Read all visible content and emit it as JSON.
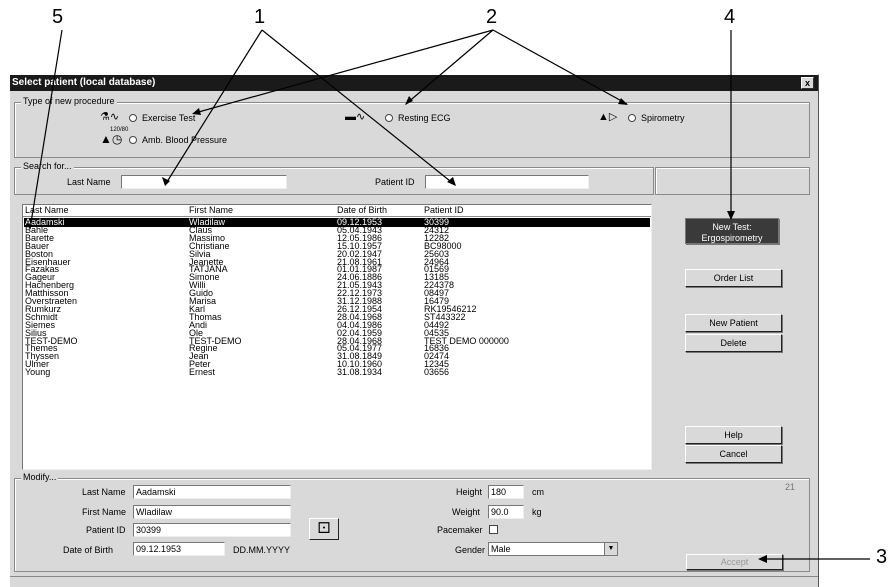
{
  "callouts": [
    "5",
    "1",
    "2",
    "4",
    "3"
  ],
  "window": {
    "title": "Select patient (local database)",
    "close": "x"
  },
  "procedure": {
    "label": "Type of new procedure",
    "exercise": "Exercise Test",
    "resting": "Resting ECG",
    "spiro": "Spirometry",
    "abp": "Amb. Blood Pressure",
    "abp_icon_text": "120/80",
    "icons": [
      "exercise-ecg-icon",
      "resting-ecg-icon",
      "spirometry-icon",
      "blood-pressure-icon"
    ]
  },
  "search": {
    "label": "Search for...",
    "last_name": "Last Name",
    "patient_id": "Patient ID"
  },
  "list": {
    "headers": [
      "Last Name",
      "First Name",
      "Date of Birth",
      "Patient ID"
    ],
    "selected_index": 0,
    "rows": [
      [
        "Aadamski",
        "Wladilaw",
        "09.12.1953",
        "30399"
      ],
      [
        "Bahle",
        "Claus",
        "05.04.1943",
        "24312"
      ],
      [
        "Barette",
        "Massimo",
        "12.05.1986",
        "12282"
      ],
      [
        "Bauer",
        "Christiane",
        "15.10.1957",
        "BC98000"
      ],
      [
        "Boston",
        "Silvia",
        "20.02.1947",
        "25603"
      ],
      [
        "Eisenhauer",
        "Jeanette",
        "21.08.1961",
        "24964"
      ],
      [
        "Fazakas",
        "TATJANA",
        "01.01.1987",
        "01569"
      ],
      [
        "Gageur",
        "Simone",
        "24.06.1886",
        "13185"
      ],
      [
        "Hachenberg",
        "Willi",
        "21.05.1943",
        "224378"
      ],
      [
        "Matthisson",
        "Guido",
        "22.12.1973",
        "08497"
      ],
      [
        "Overstraeten",
        "Marisa",
        "31.12.1988",
        "16479"
      ],
      [
        "Rumkurz",
        "Karl",
        "26.12.1954",
        "RK19546212"
      ],
      [
        "Schmidt",
        "Thomas",
        "28.04.1968",
        "ST443322"
      ],
      [
        "Siemes",
        "Andi",
        "04.04.1986",
        "04492"
      ],
      [
        "Silius",
        "Ole",
        "02.04.1959",
        "04535"
      ],
      [
        "TEST-DEMO",
        "TEST-DEMO",
        "28.04.1968",
        "TEST DEMO 000000"
      ],
      [
        "Themes",
        "Regine",
        "05.04.1977",
        "16836"
      ],
      [
        "Thyssen",
        "Jean",
        "31.08.1849",
        "02474"
      ],
      [
        "Ulmer",
        "Peter",
        "10.10.1960",
        "12345"
      ],
      [
        "Young",
        "Ernest",
        "31.08.1934",
        "03656"
      ]
    ]
  },
  "buttons": {
    "new_test_line1": "New Test:",
    "new_test_line2": "Ergospirometry",
    "order_list": "Order List",
    "new_patient": "New Patient",
    "delete": "Delete",
    "help": "Help",
    "cancel": "Cancel",
    "accept": "Accept"
  },
  "modify": {
    "label": "Modify...",
    "counter": "21",
    "last_name_label": "Last Name",
    "last_name": "Aadamski",
    "first_name_label": "First Name",
    "first_name": "Wladilaw",
    "patient_id_label": "Patient ID",
    "patient_id": "30399",
    "dob_label": "Date of Birth",
    "dob": "09.12.1953",
    "dob_format": "DD.MM.YYYY",
    "height_label": "Height",
    "height": "180",
    "height_unit": "cm",
    "weight_label": "Weight",
    "weight": "90.0",
    "weight_unit": "kg",
    "pacemaker_label": "Pacemaker",
    "pacemaker_checked": false,
    "gender_label": "Gender",
    "gender": "Male",
    "dice_icon": "dice-icon"
  }
}
